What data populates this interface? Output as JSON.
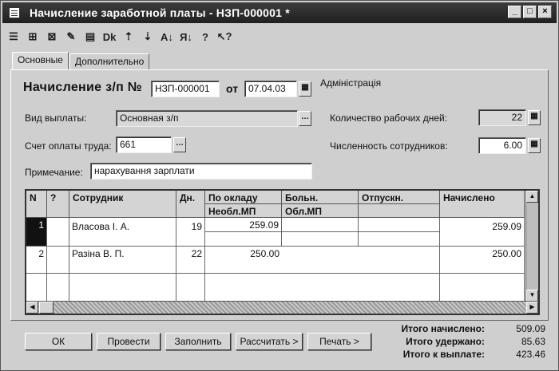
{
  "window": {
    "title": "Начисление заработной платы - НЗП-000001 *",
    "buttons": [
      "_",
      "□",
      "×"
    ]
  },
  "toolbar": {
    "icons": [
      "new-row-icon",
      "copy-row-icon",
      "delete-row-icon",
      "edit-row-icon",
      "post-icon",
      "dk-icon",
      "move-up-icon",
      "move-down-icon",
      "sort-asc-icon",
      "sort-desc-icon",
      "help-icon",
      "context-help-icon"
    ],
    "glyphs": [
      "☰",
      "⊞",
      "⊠",
      "✎",
      "▤",
      "Dk",
      "⇡",
      "⇣",
      "A↓",
      "Я↓",
      "?",
      "↖?"
    ]
  },
  "tabs": [
    {
      "label": "Основные",
      "active": true
    },
    {
      "label": "Дополнительно",
      "active": false
    }
  ],
  "header": {
    "doc_label": "Начисление з/п №",
    "doc_number": "НЗП-000001",
    "date_label": "от",
    "date": "07.04.03",
    "department": "Адміністрація"
  },
  "form": {
    "payment_type_label": "Вид выплаты:",
    "payment_type": "Основная з/п",
    "account_label": "Счет оплаты труда:",
    "account": "661",
    "note_label": "Примечание:",
    "note": "нарахування зарплати",
    "work_days_label": "Количество рабочих дней:",
    "work_days": "22",
    "employees_label": "Численность сотрудников:",
    "employees": "6.00"
  },
  "grid": {
    "columns": [
      "N",
      "?",
      "Сотрудник",
      "Дн.",
      "По окладу",
      "Больн.",
      "Отпускн.",
      "Начислено"
    ],
    "subcolumns": {
      "po_okladu": "Необл.МП",
      "boln": "Обл.МП"
    },
    "rows": [
      {
        "n": "1",
        "employee": "Власова І. А.",
        "days": "19",
        "salary": "259.09",
        "total": "259.09"
      },
      {
        "n": "2",
        "employee": "Разіна В. П.",
        "days": "22",
        "salary": "250.00",
        "total": "250.00"
      }
    ]
  },
  "buttons": {
    "ok": "ОК",
    "post": "Провести",
    "fill": "Заполнить",
    "calculate": "Рассчитать >",
    "print": "Печать >"
  },
  "totals": {
    "accrued_label": "Итого начислено:",
    "accrued": "509.09",
    "withheld_label": "Итого удержано:",
    "withheld": "85.63",
    "payout_label": "Итого к выплате:",
    "payout": "423.46"
  }
}
